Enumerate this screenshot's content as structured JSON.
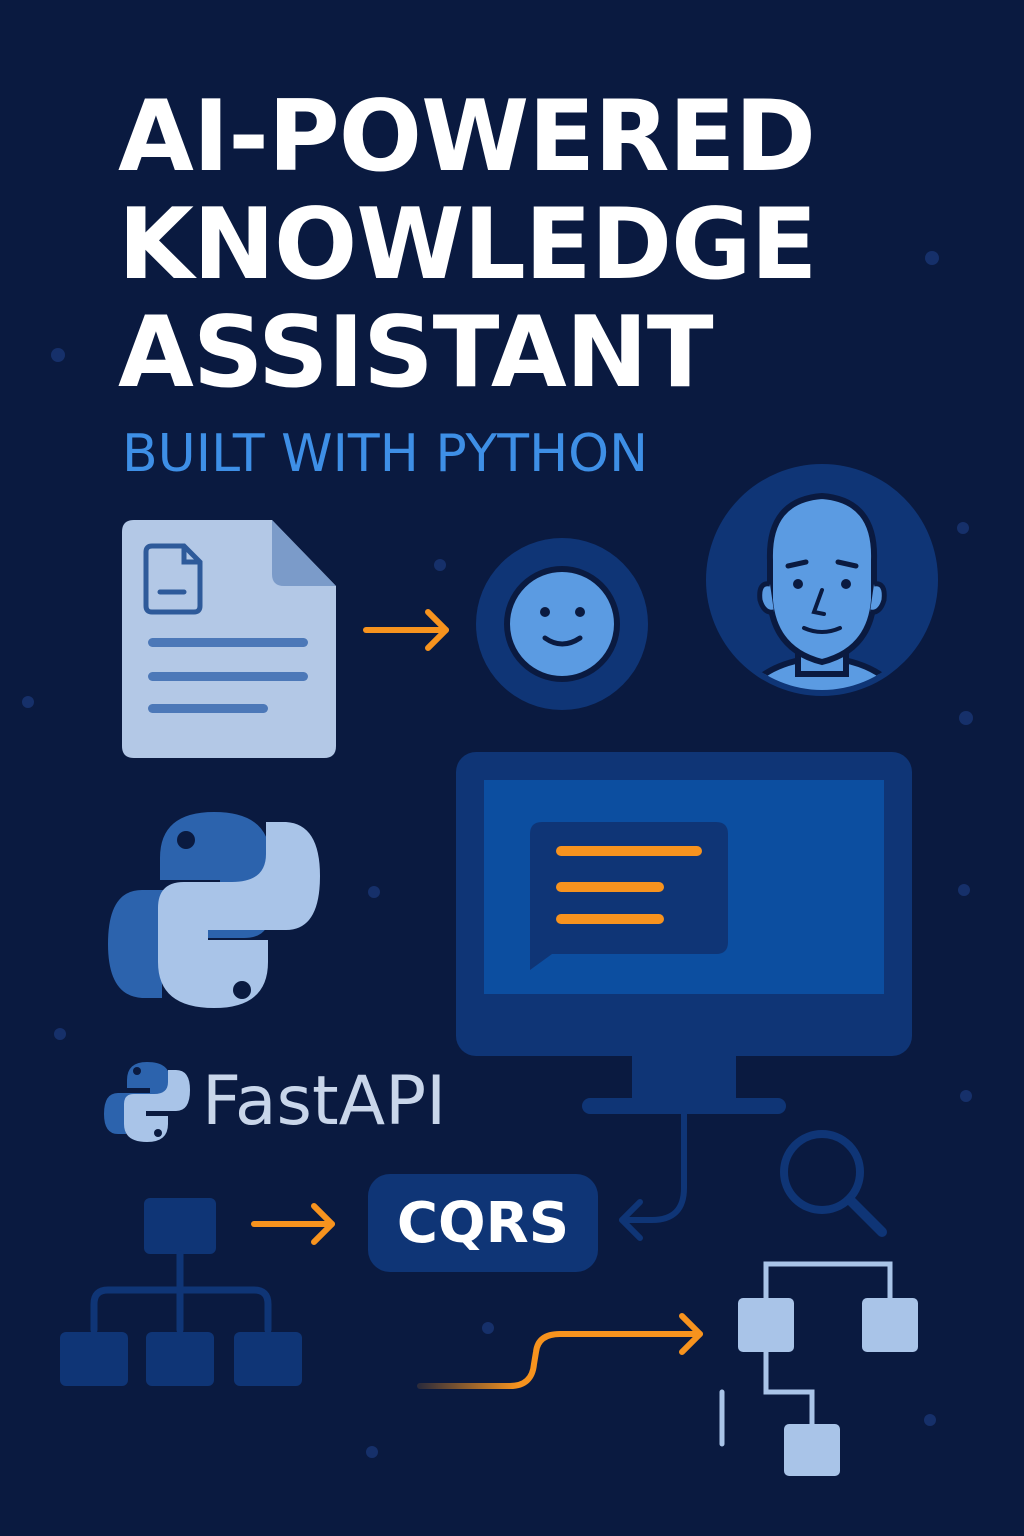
{
  "title": {
    "line1": "AI-POWERED",
    "line2": "KNOWLEDGE",
    "line3": "ASSISTANT"
  },
  "subtitle": "BUILT WITH PYTHON",
  "fastapi_label": "FastAPI",
  "cqrs_label": "CQRS",
  "colors": {
    "background": "#0a1a40",
    "accent_blue": "#3e8fe6",
    "arrow_orange": "#f7931e",
    "dark_blue": "#0f3576",
    "light_blue": "#a9c4e8"
  },
  "icons": [
    "document-icon",
    "smiley-bot-icon",
    "person-avatar-icon",
    "monitor-chat-icon",
    "python-logo-icon",
    "fastapi-python-logo-icon",
    "hierarchy-tree-icon",
    "magnifier-icon",
    "data-tree-icon"
  ]
}
